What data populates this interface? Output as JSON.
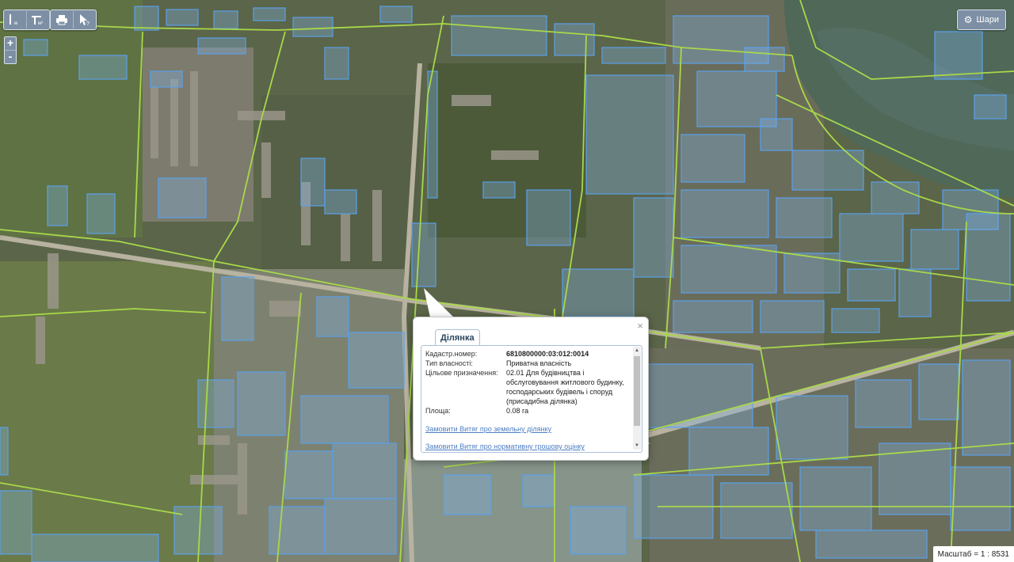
{
  "toolbar": {
    "icons": [
      "ruler-distance-icon",
      "ruler-area-icon",
      "printer-icon",
      "pointer-help-icon"
    ]
  },
  "zoom": {
    "in_label": "+",
    "out_label": "-"
  },
  "layers_button": {
    "label": "Шари",
    "icon": "gear-icon"
  },
  "popup": {
    "tab_label": "Ділянка",
    "close_label": "×",
    "rows": [
      {
        "key": "Кадастр.номер:",
        "value": "6810800000:03:012:0014"
      },
      {
        "key": "Тип власності:",
        "value": "Приватна власність"
      },
      {
        "key": "Цільове призначення:",
        "value": "02.01 Для будівництва і обслуговування житлового будинку, господарських будівель і споруд (присадибна ділянка)"
      },
      {
        "key": "Площа:",
        "value": "0.08 га"
      }
    ],
    "links": [
      "Замовити Витяг про земельну ділянку",
      "Замовити Витяг про нормативну грошову оцінку"
    ]
  },
  "scale": {
    "label": "Масштаб = 1 : 8531"
  },
  "colors": {
    "road_line": "#a8d84a",
    "parcel_fill": "#7fb2e6",
    "parcel_stroke": "#5aa0e8",
    "toolbar_bg": "#7d8fa4",
    "link": "#4d7ec2"
  }
}
